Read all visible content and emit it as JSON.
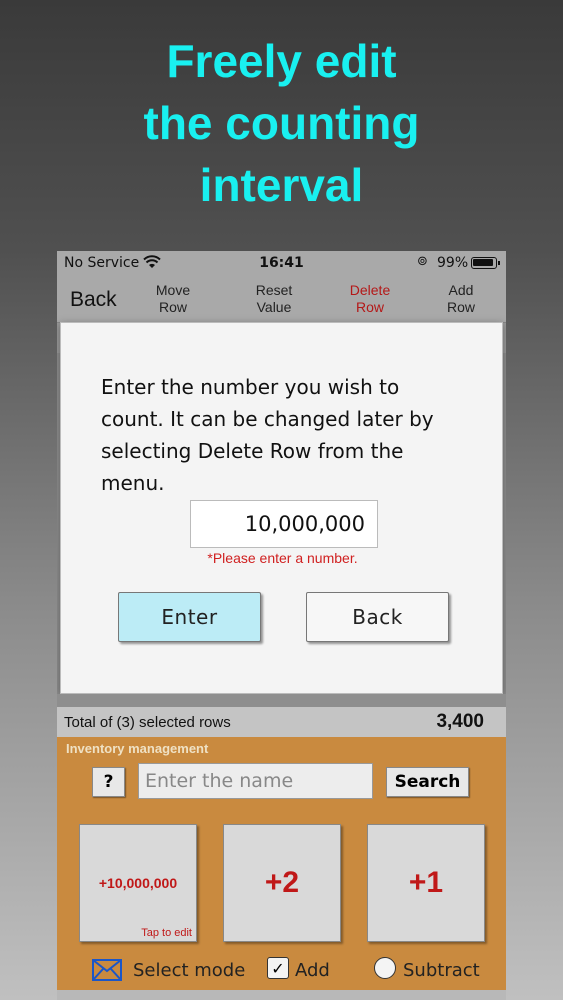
{
  "headline": [
    "Freely edit",
    "the counting",
    "interval"
  ],
  "status": {
    "carrier": "No Service",
    "time": "16:41",
    "battery": "99%"
  },
  "nav": {
    "back": "Back",
    "move_row": [
      "Move",
      "Row"
    ],
    "reset_value": [
      "Reset",
      "Value"
    ],
    "delete_row": [
      "Delete",
      "Row"
    ],
    "add_row": [
      "Add",
      "Row"
    ]
  },
  "dialog": {
    "message": "Enter the number you wish to count. It can be changed later by selecting Delete Row from the menu.",
    "input_value": "10,000,000",
    "hint": "*Please enter a number.",
    "enter_label": "Enter",
    "back_label": "Back"
  },
  "total": {
    "label": "Total of (3) selected rows",
    "value": "3,400"
  },
  "panel": {
    "title": "Inventory management",
    "help_label": "?",
    "name_placeholder": "Enter the name",
    "search_label": "Search",
    "buttons": [
      {
        "label": "+10,000,000",
        "sub": "Tap to edit"
      },
      {
        "label": "+2"
      },
      {
        "label": "+1"
      }
    ]
  },
  "bottom": {
    "select_mode": "Select mode",
    "add": "Add",
    "subtract": "Subtract"
  }
}
